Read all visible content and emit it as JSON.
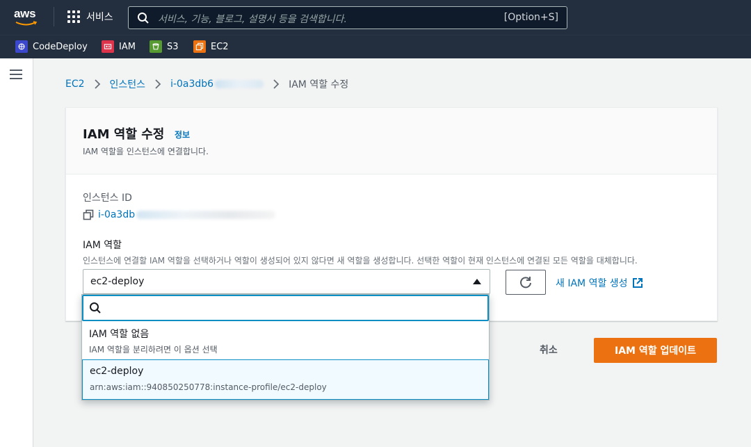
{
  "topbar": {
    "logo_text": "aws",
    "services_label": "서비스",
    "search_placeholder": "서비스, 기능, 블로그, 설명서 등을 검색합니다.",
    "search_shortcut": "[Option+S]"
  },
  "favorites": [
    {
      "label": "CodeDeploy",
      "icon": "codedeploy-icon",
      "color": "#3b48cc"
    },
    {
      "label": "IAM",
      "icon": "iam-icon",
      "color": "#dd344c"
    },
    {
      "label": "S3",
      "icon": "s3-icon",
      "color": "#569a31"
    },
    {
      "label": "EC2",
      "icon": "ec2-icon",
      "color": "#ec7211"
    }
  ],
  "breadcrumb": {
    "item1": "EC2",
    "item2": "인스턴스",
    "item3": "i-0a3db6",
    "current": "IAM 역할 수정"
  },
  "card": {
    "title": "IAM 역할 수정",
    "info": "정보",
    "description": "IAM 역할을 인스턴스에 연결합니다."
  },
  "instance": {
    "label": "인스턴스 ID",
    "id": "i-0a3db"
  },
  "iam_role": {
    "label": "IAM 역할",
    "description": "인스턴스에 연결할 IAM 역할을 선택하거나 역할이 생성되어 있지 않다면 새 역할을 생성합니다. 선택한 역할이 현재 인스턴스에 연결된 모든 역할을 대체합니다.",
    "selected": "ec2-deploy",
    "create_link": "새 IAM 역할 생성"
  },
  "dropdown": {
    "options": [
      {
        "title": "IAM 역할 없음",
        "subtitle": "IAM 역할을 분리하려면 이 옵션 선택"
      },
      {
        "title": "ec2-deploy",
        "subtitle": "arn:aws:iam::940850250778:instance-profile/ec2-deploy"
      }
    ]
  },
  "actions": {
    "cancel": "취소",
    "update": "IAM 역할 업데이트"
  },
  "colors": {
    "nav_bg": "#232f3e",
    "link": "#0073bb",
    "primary_button": "#ec7211",
    "focus": "#0a8ec3"
  }
}
